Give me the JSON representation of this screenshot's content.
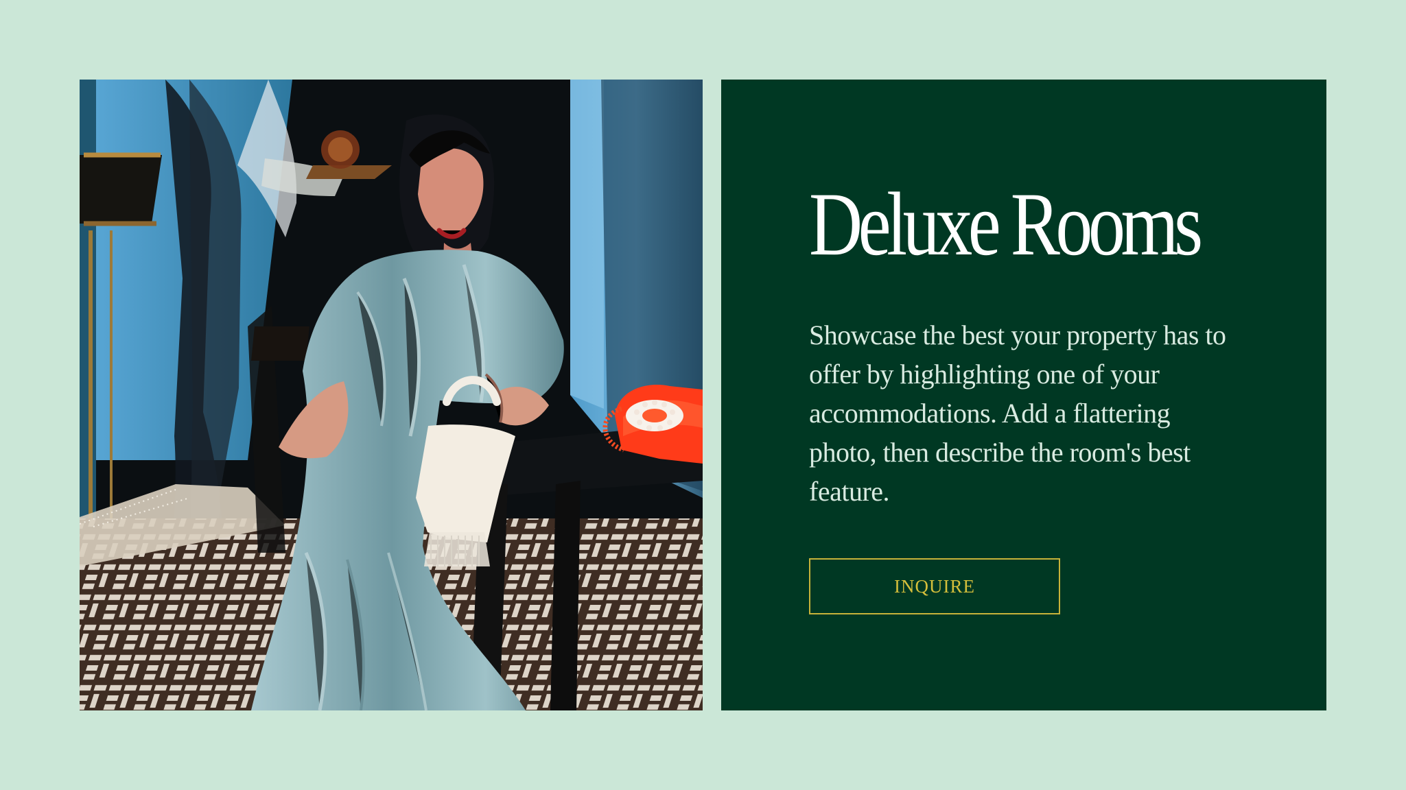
{
  "feature": {
    "title": "Deluxe Rooms",
    "description": "Showcase the best your property has to offer by highlighting one of your accommodations. Add a flattering photo, then describe the room's best feature.",
    "button_label": "INQUIRE"
  },
  "photo": {
    "icon": "room-photo"
  },
  "colors": {
    "page_background": "#cbe7d7",
    "panel_background": "#003823",
    "accent_gold": "#d5bf3b"
  }
}
